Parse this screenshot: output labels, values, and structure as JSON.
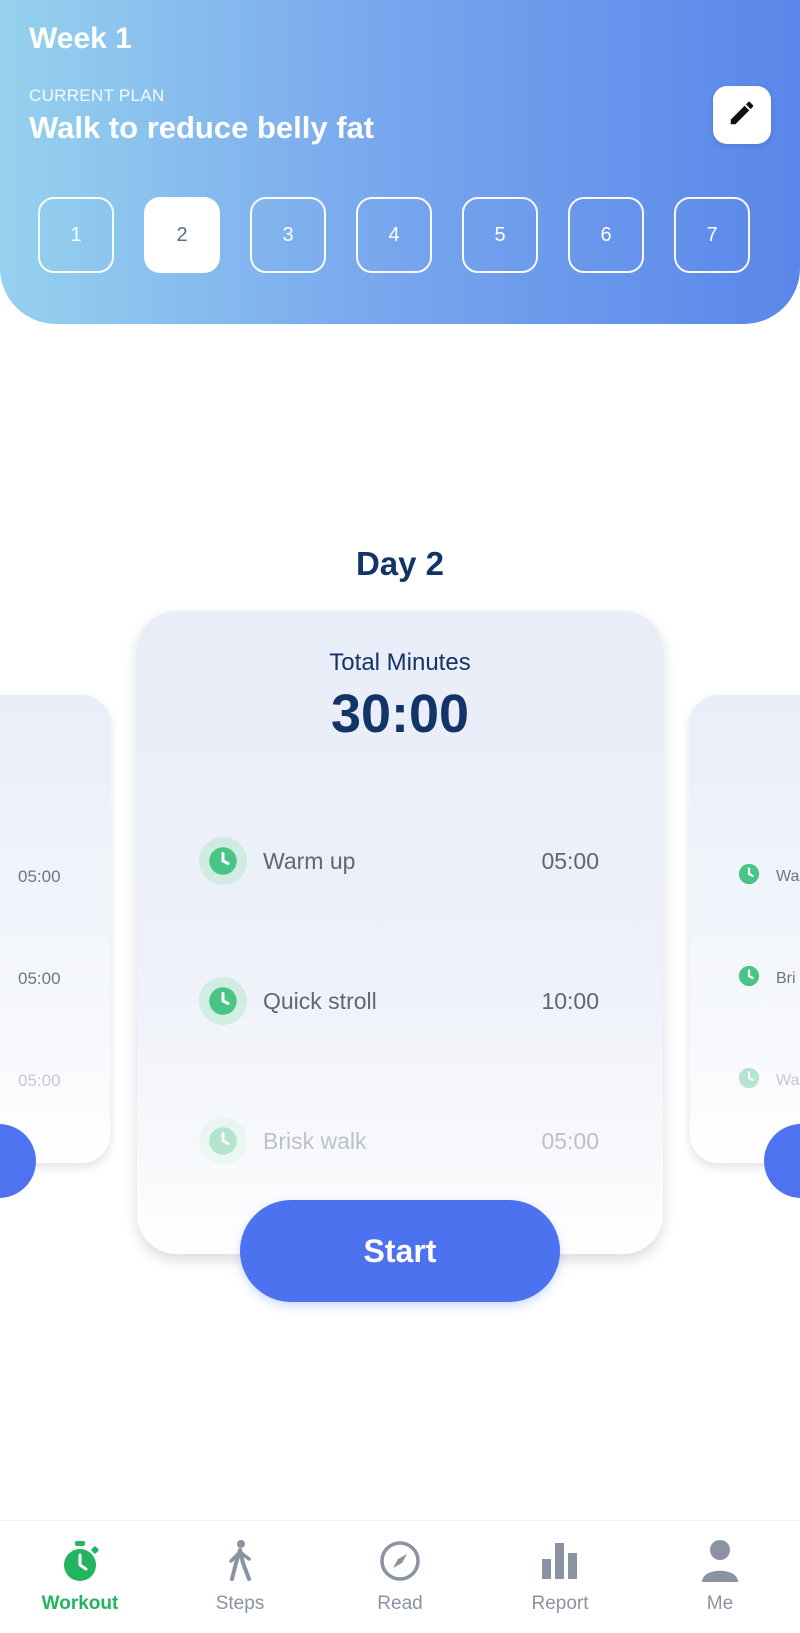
{
  "header": {
    "week_title": "Week 1",
    "plan_label": "CURRENT PLAN",
    "plan_name": "Walk to reduce belly fat",
    "edit_icon": "pencil-icon",
    "days": [
      "1",
      "2",
      "3",
      "4",
      "5",
      "6",
      "7"
    ],
    "selected_day": "2"
  },
  "day_heading": "Day 2",
  "main_card": {
    "total_label": "Total Minutes",
    "total_value": "30:00",
    "exercises": [
      {
        "name": "Warm up",
        "time": "05:00"
      },
      {
        "name": "Quick stroll",
        "time": "10:00"
      },
      {
        "name": "Brisk walk",
        "time": "05:00"
      }
    ]
  },
  "left_card": {
    "times": [
      "05:00",
      "05:00",
      "05:00"
    ]
  },
  "right_card": {
    "rows": [
      "Wa",
      "Bri",
      "Wa"
    ]
  },
  "start_label": "Start",
  "tabs": [
    {
      "label": "Workout",
      "icon": "stopwatch-icon",
      "active": true
    },
    {
      "label": "Steps",
      "icon": "walking-person-icon",
      "active": false
    },
    {
      "label": "Read",
      "icon": "compass-icon",
      "active": false
    },
    {
      "label": "Report",
      "icon": "bar-chart-icon",
      "active": false
    },
    {
      "label": "Me",
      "icon": "person-icon",
      "active": false
    }
  ],
  "colors": {
    "accent_blue": "#4d72ef",
    "active_green": "#22b45e",
    "heading_navy": "#123466",
    "header_gradient_start": "#95d2ee",
    "header_gradient_end": "#5a86ea"
  }
}
